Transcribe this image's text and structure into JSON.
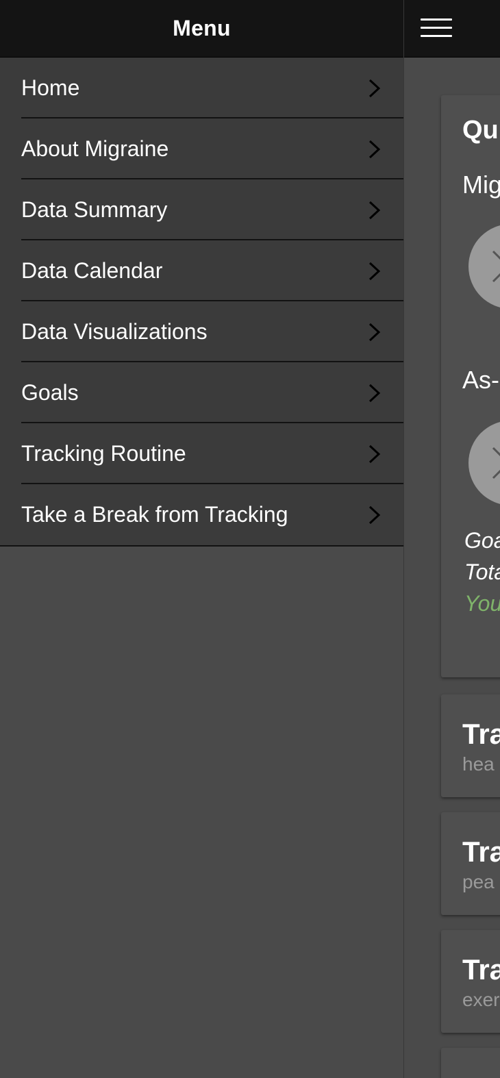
{
  "menu": {
    "title": "Menu",
    "items": [
      {
        "label": "Home"
      },
      {
        "label": "About Migraine"
      },
      {
        "label": "Data Summary"
      },
      {
        "label": "Data Calendar"
      },
      {
        "label": "Data Visualizations"
      },
      {
        "label": "Goals"
      },
      {
        "label": "Tracking Routine"
      },
      {
        "label": "Take a Break from Tracking"
      }
    ]
  },
  "header": {
    "menu_icon": "hamburger-menu-icon"
  },
  "content": {
    "quick_card": {
      "heading": "Qu",
      "migraine_label": "Mig",
      "as_needed_label": "As-",
      "goal_line": "Goa",
      "total_line": "Tota",
      "you_line": "You"
    },
    "tracking_cards": [
      {
        "title": "Tra",
        "subtitle": "hea"
      },
      {
        "title": "Tra",
        "subtitle": "pea"
      },
      {
        "title": "Tra",
        "subtitle": "exer"
      }
    ]
  },
  "colors": {
    "header_bg": "#141414",
    "menu_bg": "#3b3b3b",
    "content_bg": "#4a4a4a",
    "accent_green": "#7fb36a"
  }
}
